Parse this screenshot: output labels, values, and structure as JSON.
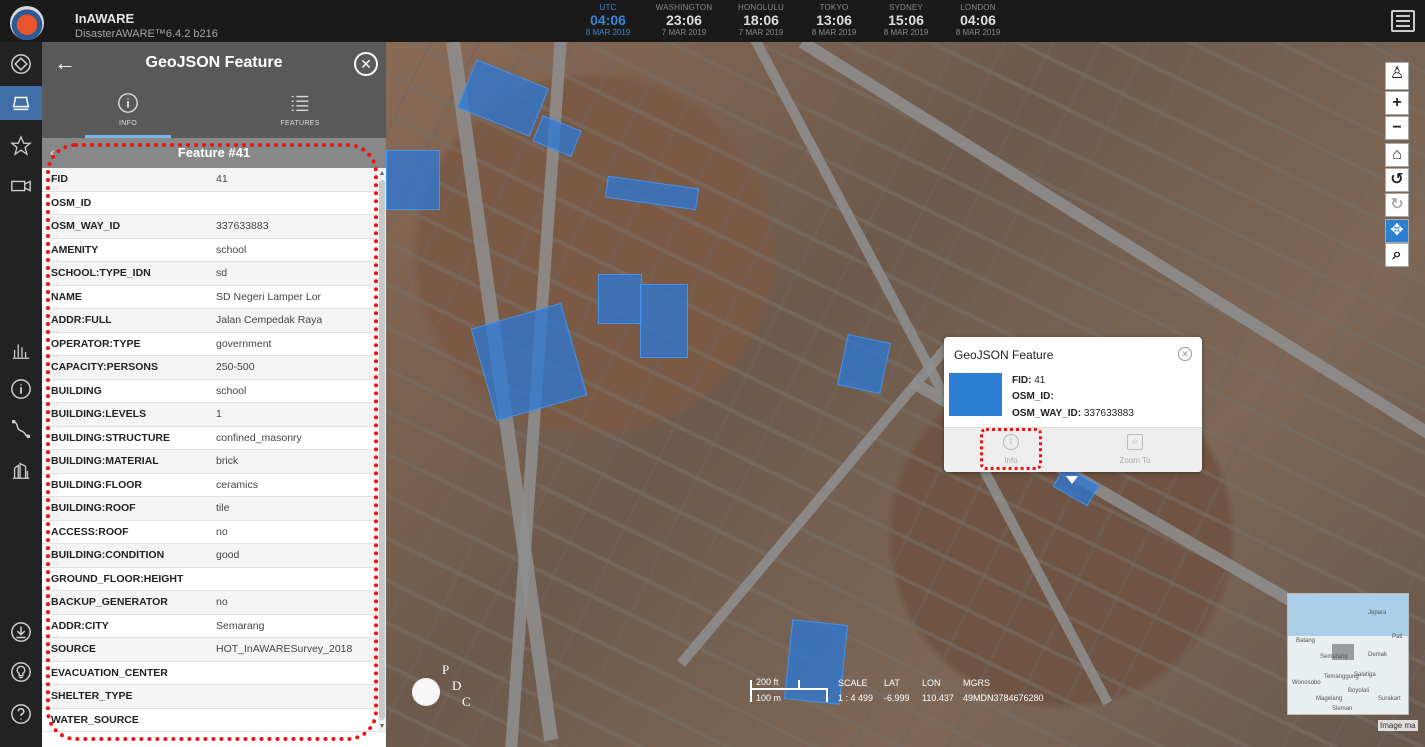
{
  "app": {
    "title": "InAWARE",
    "version": "DisasterAWARE™6.4.2 b216"
  },
  "clocks": [
    {
      "city": "UTC",
      "time": "04:06",
      "date": "8 MAR 2019"
    },
    {
      "city": "WASHINGTON",
      "time": "23:06",
      "date": "7 MAR 2019"
    },
    {
      "city": "HONOLULU",
      "time": "18:06",
      "date": "7 MAR 2019"
    },
    {
      "city": "TOKYO",
      "time": "13:06",
      "date": "8 MAR 2019"
    },
    {
      "city": "SYDNEY",
      "time": "15:06",
      "date": "8 MAR 2019"
    },
    {
      "city": "LONDON",
      "time": "04:06",
      "date": "8 MAR 2019"
    }
  ],
  "panel": {
    "title": "GeoJSON Feature",
    "tabs": [
      {
        "label": "INFO",
        "active": true
      },
      {
        "label": "FEATURES",
        "active": false
      }
    ],
    "feature_title": "Feature #41",
    "attributes": [
      {
        "key": "FID",
        "value": "41"
      },
      {
        "key": "OSM_ID",
        "value": ""
      },
      {
        "key": "OSM_WAY_ID",
        "value": "337633883"
      },
      {
        "key": "AMENITY",
        "value": "school"
      },
      {
        "key": "SCHOOL:TYPE_IDN",
        "value": "sd"
      },
      {
        "key": "NAME",
        "value": "SD Negeri Lamper Lor"
      },
      {
        "key": "ADDR:FULL",
        "value": "Jalan Cempedak Raya"
      },
      {
        "key": "OPERATOR:TYPE",
        "value": "government"
      },
      {
        "key": "CAPACITY:PERSONS",
        "value": "250-500"
      },
      {
        "key": "BUILDING",
        "value": "school"
      },
      {
        "key": "BUILDING:LEVELS",
        "value": "1"
      },
      {
        "key": "BUILDING:STRUCTURE",
        "value": "confined_masonry"
      },
      {
        "key": "BUILDING:MATERIAL",
        "value": "brick"
      },
      {
        "key": "BUILDING:FLOOR",
        "value": "ceramics"
      },
      {
        "key": "BUILDING:ROOF",
        "value": "tile"
      },
      {
        "key": "ACCESS:ROOF",
        "value": "no"
      },
      {
        "key": "BUILDING:CONDITION",
        "value": "good"
      },
      {
        "key": "GROUND_FLOOR:HEIGHT",
        "value": ""
      },
      {
        "key": "BACKUP_GENERATOR",
        "value": "no"
      },
      {
        "key": "ADDR:CITY",
        "value": "Semarang"
      },
      {
        "key": "SOURCE",
        "value": "HOT_InAWARESurvey_2018"
      },
      {
        "key": "EVACUATION_CENTER",
        "value": ""
      },
      {
        "key": "SHELTER_TYPE",
        "value": ""
      },
      {
        "key": "WATER_SOURCE",
        "value": ""
      }
    ]
  },
  "popup": {
    "title": "GeoJSON Feature",
    "fields": [
      {
        "label": "FID:",
        "value": "41"
      },
      {
        "label": "OSM_ID:",
        "value": ""
      },
      {
        "label": "OSM_WAY_ID:",
        "value": "337633883"
      }
    ],
    "actions": {
      "info": "Info",
      "zoom": "Zoom To"
    },
    "swatch_color": "#2b7fd4"
  },
  "map_footer": {
    "scale_ft": "200 ft",
    "scale_m": "100 m",
    "labels": [
      "SCALE",
      "LAT",
      "LON",
      "MGRS"
    ],
    "values": [
      "1 : 4 499",
      "-6.999",
      "110.437",
      "49MDN3784676280"
    ],
    "image_credit": "Image ma"
  },
  "minimap": {
    "labels": [
      "Jepara",
      "Batang",
      "Semarang",
      "Demak",
      "Wonosobo",
      "Temanggung",
      "Boyolali",
      "Magelang",
      "Sleman",
      "Surakart",
      "Salatiga",
      "Pati"
    ]
  },
  "pdc_logo": {
    "letters": [
      "P",
      "D",
      "C"
    ]
  },
  "colors": {
    "accent": "#3f6fa6",
    "building_fill": "#2878dc",
    "highlight_outline": "#e11111",
    "topbar": "#1a1a1a",
    "panel_header": "#595959"
  }
}
